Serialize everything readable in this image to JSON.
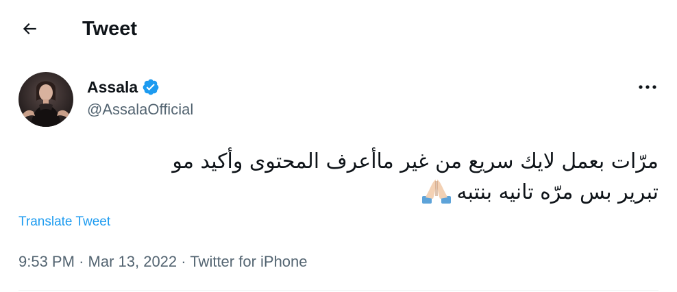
{
  "header": {
    "title": "Tweet",
    "back_icon": "arrow-left-icon"
  },
  "tweet": {
    "author": {
      "name": "Assala",
      "handle": "@AssalaOfficial",
      "verified": true,
      "verified_color": "#1d9bf0"
    },
    "text_lines": [
      "مرّات بعمل لايك سريع من غير ماأعرف المحتوى وأكيد مو",
      "تبرير بس مرّه تانيه بنتبه"
    ],
    "emoji": "folded-hands-icon",
    "translate_label": "Translate Tweet",
    "time": "9:53 PM",
    "separator": "·",
    "date": "Mar 13, 2022",
    "source": "Twitter for iPhone"
  },
  "colors": {
    "accent": "#1d9bf0",
    "text": "#0f1419",
    "secondary": "#536471"
  }
}
